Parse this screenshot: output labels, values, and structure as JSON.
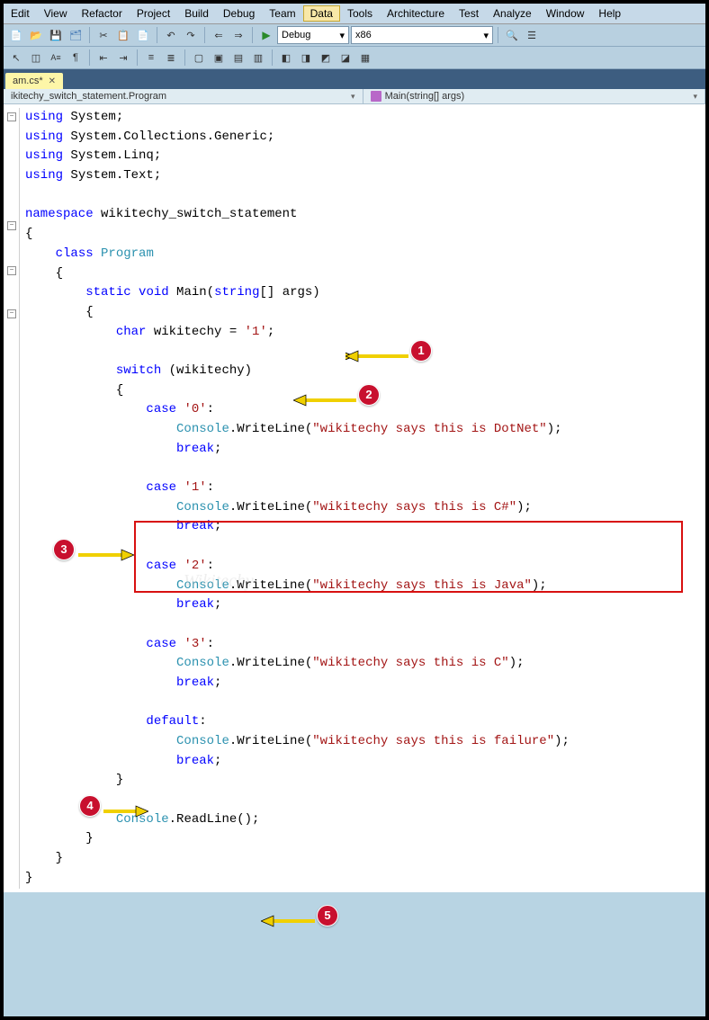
{
  "menu": [
    "Edit",
    "View",
    "Refactor",
    "Project",
    "Build",
    "Debug",
    "Team",
    "Data",
    "Tools",
    "Architecture",
    "Test",
    "Analyze",
    "Window",
    "Help"
  ],
  "menu_highlighted": "Data",
  "toolbar": {
    "debug_mode": "Debug",
    "platform": "x86"
  },
  "tab": {
    "filename": "am.cs*"
  },
  "breadcrumb": {
    "namespace": "ikitechy_switch_statement.Program",
    "method": "Main(string[] args)"
  },
  "code": {
    "using1": {
      "kw": "using",
      "rest": " System;"
    },
    "using2": {
      "kw": "using",
      "rest": " System.Collections.Generic;"
    },
    "using3": {
      "kw": "using",
      "rest": " System.Linq;"
    },
    "using4": {
      "kw": "using",
      "rest": " System.Text;"
    },
    "namespace_kw": "namespace",
    "namespace_name": " wikitechy_switch_statement",
    "class_kw": "class",
    "class_name": "Program",
    "static_kw": "static",
    "void_kw": "void",
    "main": " Main(",
    "string_kw": "string",
    "args": "[] args)",
    "char_kw": "char",
    "char_var": " wikitechy = ",
    "char_val": "'1'",
    "semi": ";",
    "switch_kw": "switch",
    "switch_cond": " (wikitechy)",
    "case_kw": "case",
    "case0_val": "'0'",
    "console": "Console",
    "writeline": ".WriteLine(",
    "str0": "\"wikitechy says this is DotNet\"",
    "break_kw": "break",
    "case1_val": "'1'",
    "str1": "\"wikitechy says this is C#\"",
    "case2_val": "'2'",
    "str2": "\"wikitechy says this is Java\"",
    "case3_val": "'3'",
    "str3": "\"wikitechy says this is C\"",
    "default_kw": "default",
    "str_default": "\"wikitechy says this is failure\"",
    "readline": ".ReadLine();"
  },
  "annotations": {
    "n1": "1",
    "n2": "2",
    "n3": "3",
    "n4": "4",
    "n5": "5"
  },
  "watermark": "Wikitechy"
}
